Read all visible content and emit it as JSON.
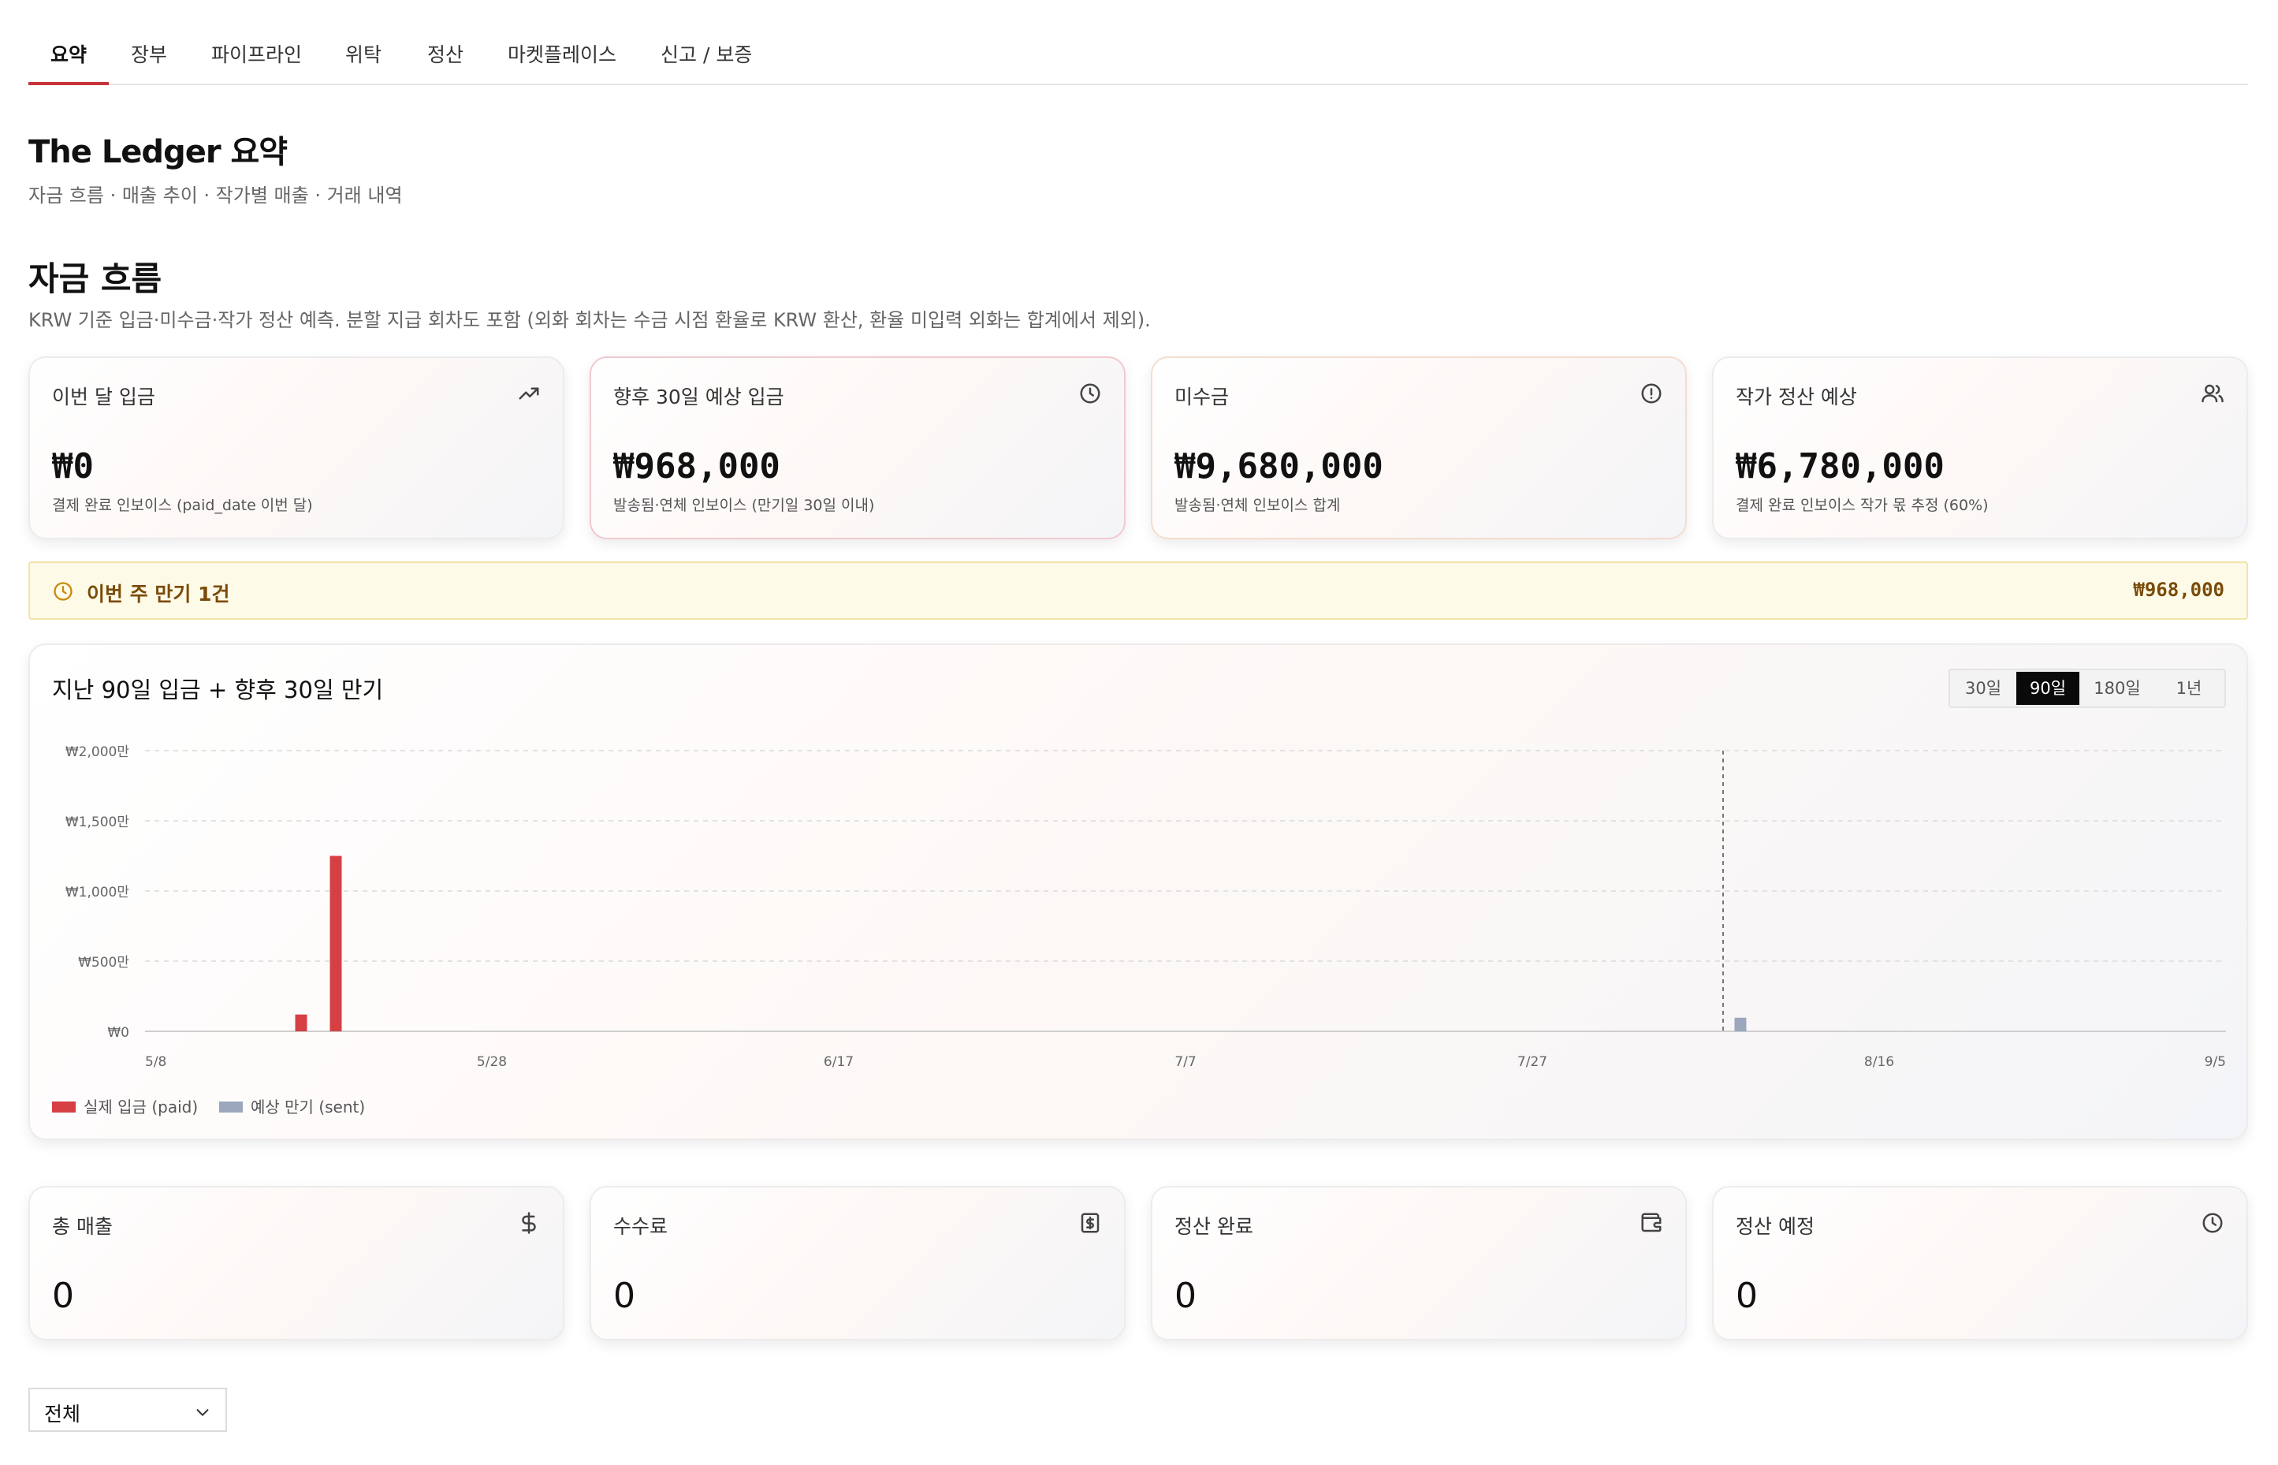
{
  "tabs": [
    {
      "label": "요약",
      "active": true
    },
    {
      "label": "장부"
    },
    {
      "label": "파이프라인"
    },
    {
      "label": "위탁"
    },
    {
      "label": "정산"
    },
    {
      "label": "마켓플레이스"
    },
    {
      "label": "신고 / 보증"
    }
  ],
  "header": {
    "title": "The Ledger 요약",
    "subtitle": "자금 흐름 · 매출 추이 · 작가별 매출 · 거래 내역"
  },
  "cashflow": {
    "title": "자금 흐름",
    "description": "KRW 기준 입금·미수금·작가 정산 예측. 분할 지급 회차도 포함 (외화 회차는 수금 시점 환율로 KRW 환산, 환율 미입력 외화는 합계에서 제외).",
    "cards": [
      {
        "label": "이번 달 입금",
        "value": "₩0",
        "note": "결제 완료 인보이스 (paid_date 이번 달)",
        "icon": "trending-up-icon"
      },
      {
        "label": "향후 30일 예상 입금",
        "value": "₩968,000",
        "note": "발송됨·연체 인보이스 (만기일 30일 이내)",
        "icon": "clock-icon"
      },
      {
        "label": "미수금",
        "value": "₩9,680,000",
        "note": "발송됨·연체 인보이스 합계",
        "icon": "alert-circle-icon"
      },
      {
        "label": "작가 정산 예상",
        "value": "₩6,780,000",
        "note": "결제 완료 인보이스 작가 몫 추정 (60%)",
        "icon": "users-icon"
      }
    ]
  },
  "banner": {
    "text": "이번 주 만기 1건",
    "amount": "₩968,000",
    "icon": "clock-icon",
    "color": "#7a4b08"
  },
  "chart_panel": {
    "title": "지난 90일 입금 + 향후 30일 만기",
    "ranges": [
      "30일",
      "90일",
      "180일",
      "1년"
    ],
    "selected_range": "90일"
  },
  "chart_data": {
    "type": "bar",
    "title": "지난 90일 입금 + 향후 30일 만기",
    "xlabel": "",
    "ylabel": "",
    "x_range": [
      "2025-05-08",
      "2025-09-05"
    ],
    "x_tick_labels": [
      "5/8",
      "5/28",
      "6/17",
      "7/7",
      "7/27",
      "8/16",
      "9/5"
    ],
    "x_tick_dates": [
      "2025-05-08",
      "2025-05-28",
      "2025-06-17",
      "2025-07-07",
      "2025-07-27",
      "2025-08-16",
      "2025-09-05"
    ],
    "ylim": [
      0,
      20000000
    ],
    "y_ticks": [
      0,
      5000000,
      10000000,
      15000000,
      20000000
    ],
    "y_tick_labels": [
      "₩0",
      "₩500만",
      "₩1,000만",
      "₩1,500만",
      "₩2,000만"
    ],
    "today_marker": "2025-08-07",
    "grid": true,
    "legend_position": "bottom-left",
    "series": [
      {
        "name": "실제 입금 (paid)",
        "color": "#d64045",
        "points": [
          {
            "x": "2025-05-17",
            "y": 1200000
          },
          {
            "x": "2025-05-19",
            "y": 12500000
          }
        ]
      },
      {
        "name": "예상 만기 (sent)",
        "color": "#9aa7bd",
        "points": [
          {
            "x": "2025-08-08",
            "y": 968000
          }
        ]
      }
    ]
  },
  "totals": {
    "cards": [
      {
        "label": "총 매출",
        "value": "0",
        "icon": "dollar-icon"
      },
      {
        "label": "수수료",
        "value": "0",
        "icon": "receipt-icon"
      },
      {
        "label": "정산 완료",
        "value": "0",
        "icon": "wallet-icon"
      },
      {
        "label": "정산 예정",
        "value": "0",
        "icon": "clock-icon"
      }
    ]
  },
  "filter": {
    "selected": "전체",
    "icon": "chevron-down-icon"
  }
}
